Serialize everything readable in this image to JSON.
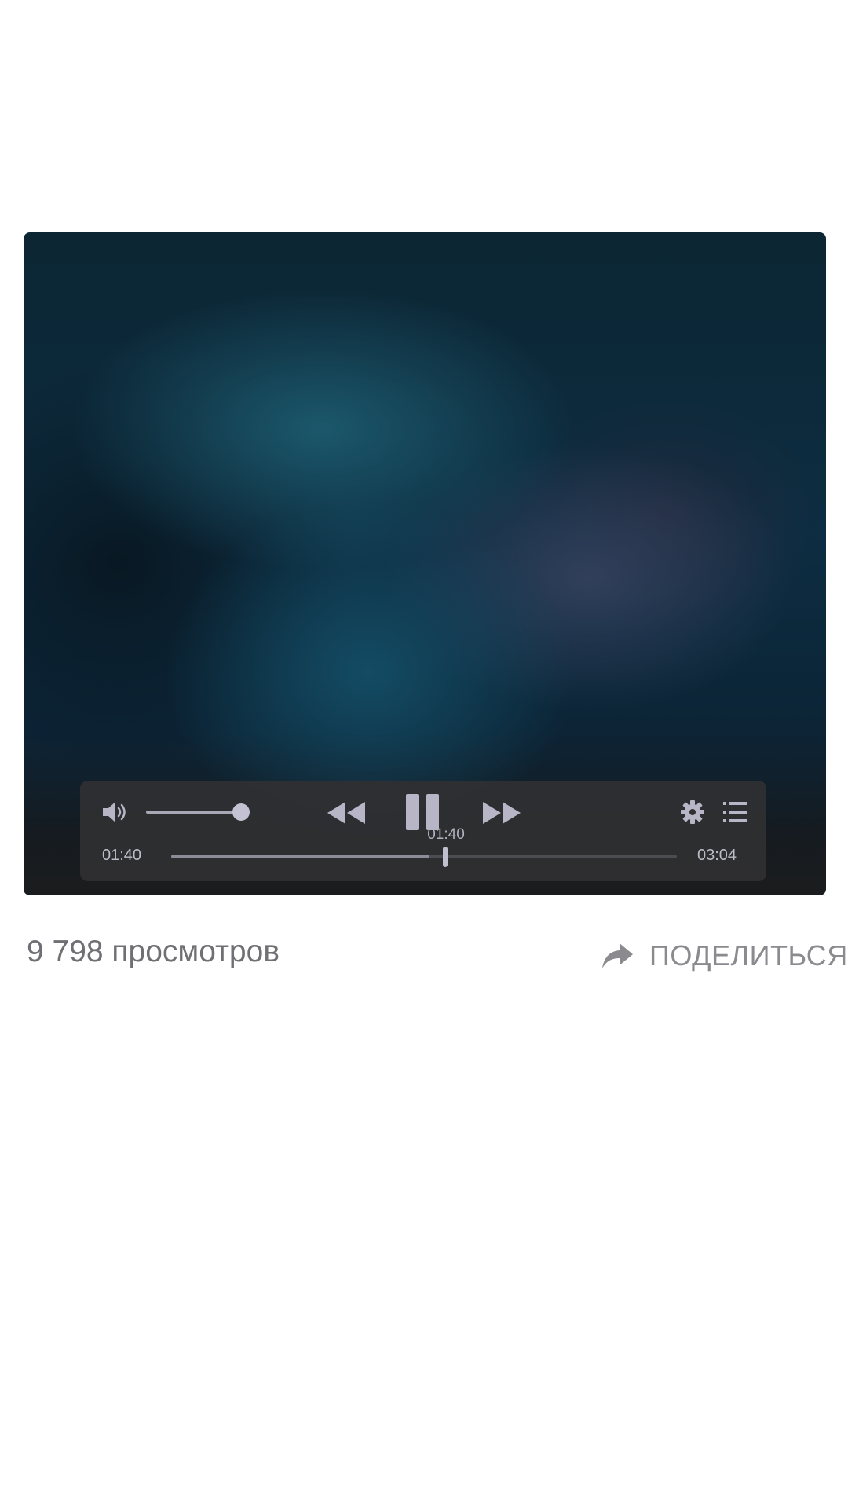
{
  "player": {
    "current_time": "01:40",
    "total_time": "03:04",
    "hover_time": "01:40",
    "progress": 0.51,
    "volume": 1.0,
    "state": "playing",
    "icons": [
      "volume-icon",
      "rewind-icon",
      "pause-icon",
      "fast-forward-icon",
      "gear-icon",
      "playlist-icon"
    ]
  },
  "stats": {
    "views_label": "9 798 просмотров"
  },
  "share": {
    "label": "ПОДЕЛИТЬСЯ",
    "icon": "share-arrow-icon"
  },
  "colors": {
    "control_bar": "#303032",
    "control_icon": "#b8b5c6",
    "views_text": "#6f6f74",
    "share_text": "#8a8a8f"
  }
}
